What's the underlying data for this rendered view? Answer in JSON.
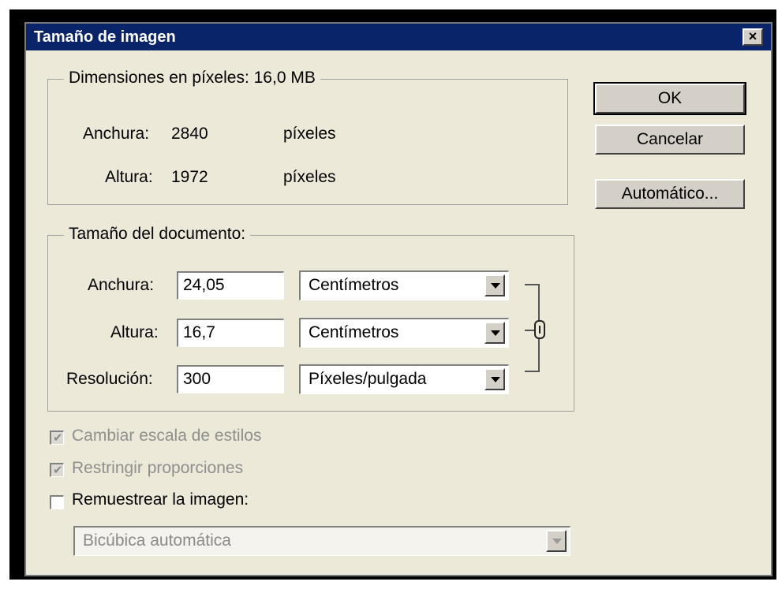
{
  "dialog": {
    "title": "Tamaño de imagen",
    "close_label": "×"
  },
  "pixel_dimensions": {
    "legend": "Dimensiones en píxeles: 16,0 MB",
    "width_label": "Anchura:",
    "width_value": "2840",
    "width_unit": "píxeles",
    "height_label": "Altura:",
    "height_value": "1972",
    "height_unit": "píxeles"
  },
  "document_size": {
    "legend": "Tamaño del documento:",
    "width_label": "Anchura:",
    "width_value": "24,05",
    "width_unit": "Centímetros",
    "height_label": "Altura:",
    "height_value": "16,7",
    "height_unit": "Centímetros",
    "resolution_label": "Resolución:",
    "resolution_value": "300",
    "resolution_unit": "Píxeles/pulgada"
  },
  "options": {
    "scale_styles_label": "Cambiar escala de estilos",
    "scale_styles_checked": true,
    "constrain_label": "Restringir proporciones",
    "constrain_checked": true,
    "resample_label": "Remuestrear la imagen:",
    "resample_checked": false,
    "resample_method": "Bicúbica automática"
  },
  "buttons": {
    "ok": "OK",
    "cancel": "Cancelar",
    "auto": "Automático..."
  },
  "icons": {
    "link": "chain-link-icon",
    "close": "close-icon",
    "dropdown": "chevron-down-icon"
  }
}
